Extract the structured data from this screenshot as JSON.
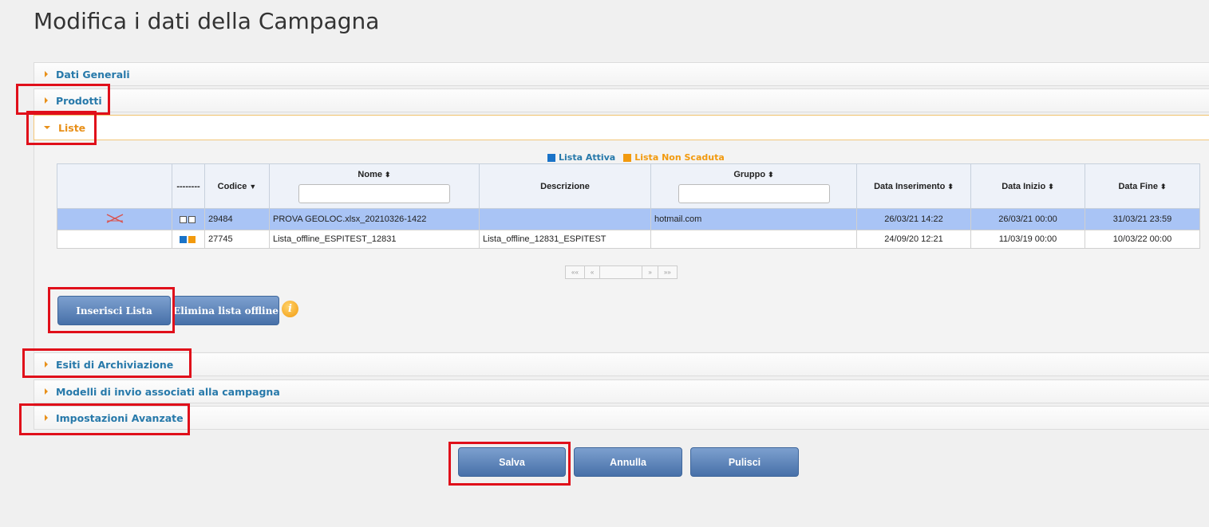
{
  "page": {
    "title": "Modifica i dati della Campagna"
  },
  "sections": {
    "dati_generali": "Dati Generali",
    "prodotti": "Prodotti",
    "liste": "Liste",
    "esiti": "Esiti di Archiviazione",
    "modelli": "Modelli di invio associati alla campagna",
    "impostazioni": "Impostazioni Avanzate"
  },
  "legend": {
    "active": "Lista Attiva",
    "non_scaduta": "Lista Non Scaduta",
    "active_color": "#1a73c8",
    "non_scaduta_color": "#f29a0e"
  },
  "table": {
    "headers": {
      "dashes": "--------",
      "codice": "Codice",
      "nome": "Nome",
      "descrizione": "Descrizione",
      "gruppo": "Gruppo",
      "data_inserimento": "Data Inserimento",
      "data_inizio": "Data Inizio",
      "data_fine": "Data Fine"
    },
    "sort_asc_desc": "⬍",
    "sort_down": "▼",
    "rows": [
      {
        "codice": "29484",
        "nome": "PROVA GEOLOC.xlsx_20210326-1422",
        "descrizione": "",
        "gruppo": "hotmail.com",
        "data_inserimento": "26/03/21 14:22",
        "data_inizio": "26/03/21 00:00",
        "data_fine": "31/03/21 23:59",
        "selected": true,
        "status_icons": [
          "empty",
          "empty"
        ],
        "delete_icon": "delete-x-icon"
      },
      {
        "codice": "27745",
        "nome": "Lista_offline_ESPITEST_12831",
        "descrizione": "Lista_offline_12831_ESPITEST",
        "gruppo": "",
        "data_inserimento": "24/09/20 12:21",
        "data_inizio": "11/03/19 00:00",
        "data_fine": "10/03/22 00:00",
        "selected": false,
        "status_icons": [
          "blue",
          "orange"
        ]
      }
    ]
  },
  "pager": {
    "first": "««",
    "prev": "«",
    "next": "»",
    "last": "»»"
  },
  "buttons": {
    "inserisci": "Inserisci Lista",
    "elimina": "Elimina lista offline",
    "info": "i",
    "salva": "Salva",
    "annulla": "Annulla",
    "pulisci": "Pulisci"
  }
}
